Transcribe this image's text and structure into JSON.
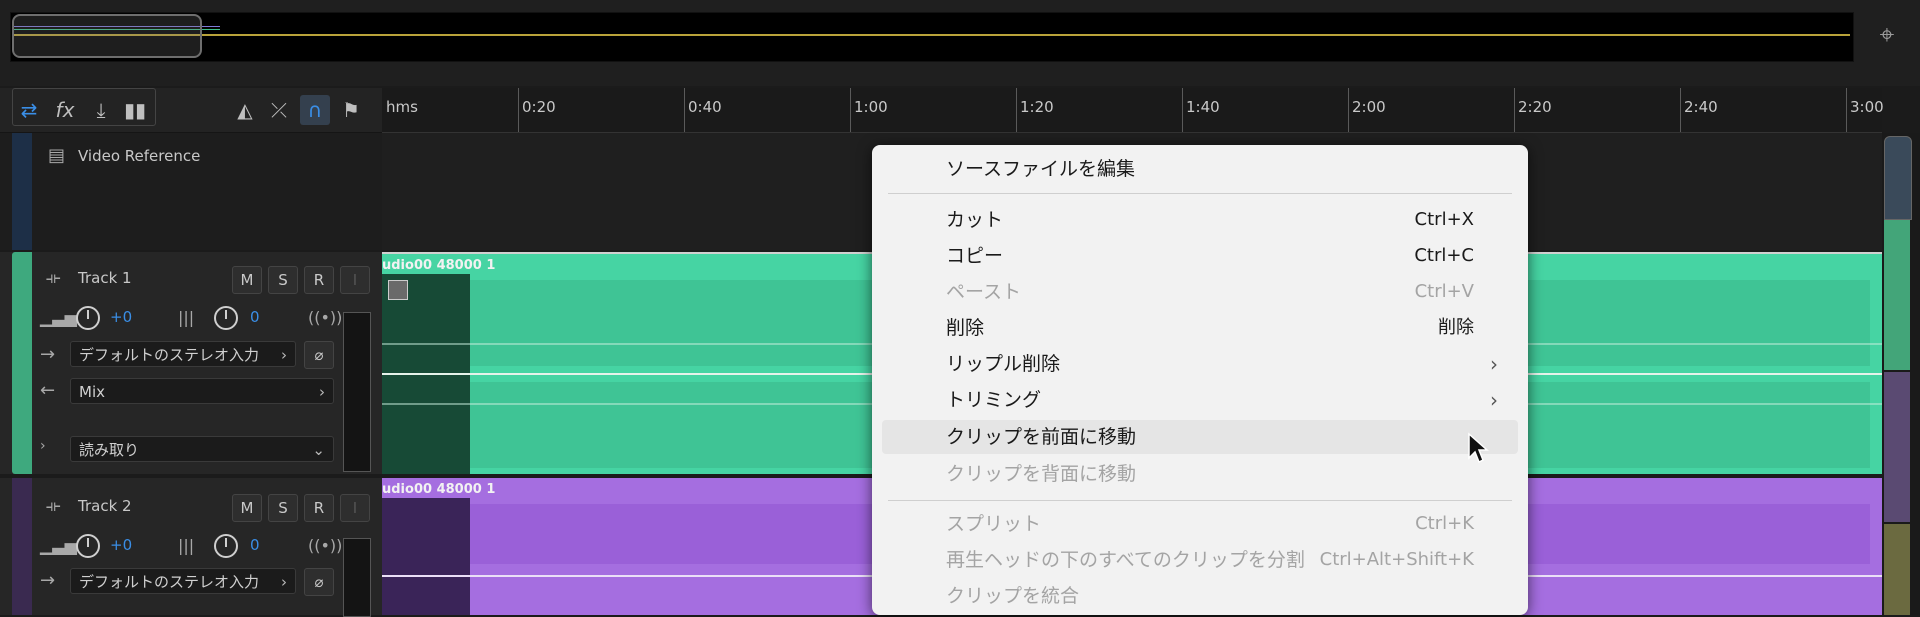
{
  "ruler": {
    "unit_label": "hms",
    "ticks": [
      "0:20",
      "0:40",
      "1:00",
      "1:20",
      "1:40",
      "2:00",
      "2:20",
      "2:40",
      "3:00"
    ]
  },
  "toolbar": {
    "icons": [
      "swap-icon",
      "fx-icon",
      "send-icon",
      "bar-chart-icon",
      "metronome-icon",
      "snap-icon",
      "magnet-icon",
      "marker-icon"
    ]
  },
  "tracks": {
    "video": {
      "name": "Video Reference"
    },
    "track1": {
      "name": "Track 1",
      "m": "M",
      "s": "S",
      "r": "R",
      "i": "I",
      "volume": "+0",
      "pan": "0",
      "input": "デフォルトのステレオ入力",
      "output": "Mix",
      "automation": "読み取り",
      "clip_title": "udio00 48000 1",
      "color": "#46d4a3"
    },
    "track2": {
      "name": "Track 2",
      "m": "M",
      "s": "S",
      "r": "R",
      "i": "I",
      "volume": "+0",
      "pan": "0",
      "input": "デフォルトのステレオ入力",
      "clip_title": "udio00 48000 1",
      "color": "#a56ee0"
    }
  },
  "context_menu": {
    "items": [
      {
        "label": "ソースファイルを編集",
        "shortcut": "",
        "disabled": false
      },
      {
        "label": "カット",
        "shortcut": "Ctrl+X",
        "disabled": false
      },
      {
        "label": "コピー",
        "shortcut": "Ctrl+C",
        "disabled": false
      },
      {
        "label": "ペースト",
        "shortcut": "Ctrl+V",
        "disabled": true
      },
      {
        "label": "削除",
        "shortcut": "削除",
        "disabled": false
      },
      {
        "label": "リップル削除",
        "shortcut": "",
        "submenu": true,
        "disabled": false
      },
      {
        "label": "トリミング",
        "shortcut": "",
        "submenu": true,
        "disabled": false
      },
      {
        "label": "クリップを前面に移動",
        "shortcut": "",
        "disabled": false,
        "hovered": true
      },
      {
        "label": "クリップを背面に移動",
        "shortcut": "",
        "disabled": true
      },
      {
        "label": "スプリット",
        "shortcut": "Ctrl+K",
        "disabled": true
      },
      {
        "label": "再生ヘッドの下のすべてのクリップを分割",
        "shortcut": "Ctrl+Alt+Shift+K",
        "disabled": true
      },
      {
        "label": "クリップを統合",
        "shortcut": "",
        "disabled": true
      }
    ]
  }
}
